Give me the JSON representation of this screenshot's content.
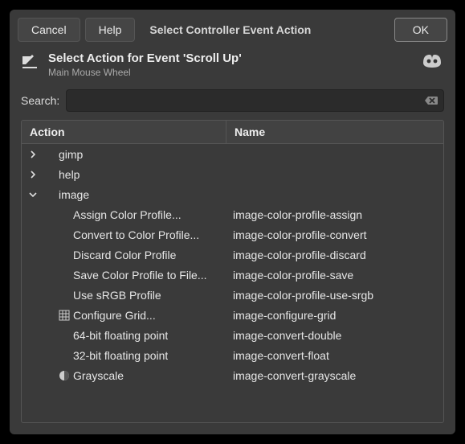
{
  "buttons": {
    "cancel": "Cancel",
    "help": "Help",
    "ok": "OK"
  },
  "title": "Select Controller Event Action",
  "header": {
    "title": "Select Action for Event 'Scroll Up'",
    "subtitle": "Main Mouse Wheel"
  },
  "search": {
    "label": "Search:",
    "value": ""
  },
  "columns": {
    "action": "Action",
    "name": "Name"
  },
  "rows": [
    {
      "depth": 0,
      "expander": "right",
      "icon": "",
      "label": "gimp",
      "name": ""
    },
    {
      "depth": 0,
      "expander": "right",
      "icon": "",
      "label": "help",
      "name": ""
    },
    {
      "depth": 0,
      "expander": "down",
      "icon": "",
      "label": "image",
      "name": ""
    },
    {
      "depth": 1,
      "expander": "",
      "icon": "",
      "label": "Assign Color Profile...",
      "name": "image-color-profile-assign"
    },
    {
      "depth": 1,
      "expander": "",
      "icon": "",
      "label": "Convert to Color Profile...",
      "name": "image-color-profile-convert"
    },
    {
      "depth": 1,
      "expander": "",
      "icon": "",
      "label": "Discard Color Profile",
      "name": "image-color-profile-discard"
    },
    {
      "depth": 1,
      "expander": "",
      "icon": "",
      "label": "Save Color Profile to File...",
      "name": "image-color-profile-save"
    },
    {
      "depth": 1,
      "expander": "",
      "icon": "",
      "label": "Use sRGB Profile",
      "name": "image-color-profile-use-srgb"
    },
    {
      "depth": 1,
      "expander": "",
      "icon": "grid",
      "label": "Configure Grid...",
      "name": "image-configure-grid"
    },
    {
      "depth": 1,
      "expander": "",
      "icon": "",
      "label": "64-bit floating point",
      "name": "image-convert-double"
    },
    {
      "depth": 1,
      "expander": "",
      "icon": "",
      "label": "32-bit floating point",
      "name": "image-convert-float"
    },
    {
      "depth": 1,
      "expander": "",
      "icon": "grayscale",
      "label": "Grayscale",
      "name": "image-convert-grayscale"
    }
  ]
}
